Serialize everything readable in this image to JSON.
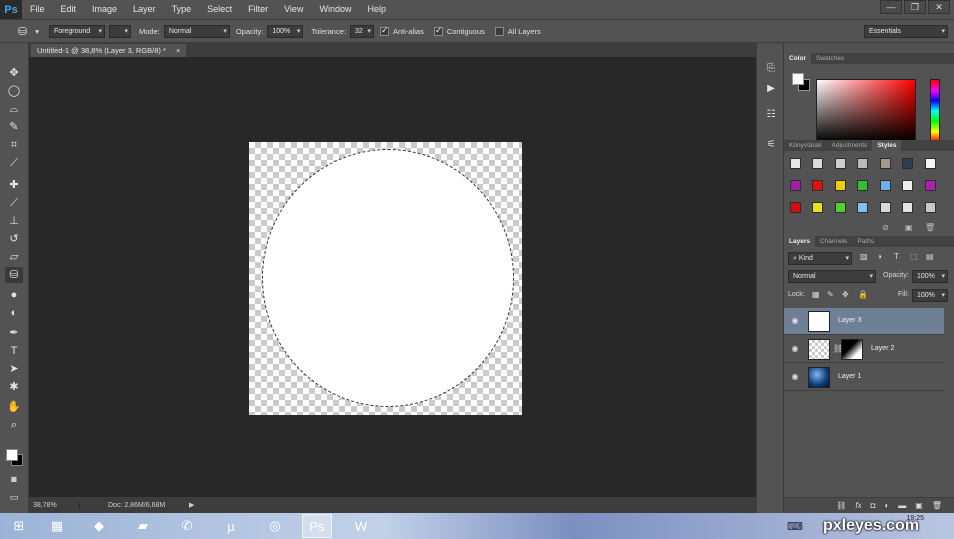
{
  "app": {
    "logo": "Ps"
  },
  "menu": [
    "File",
    "Edit",
    "Image",
    "Layer",
    "Type",
    "Select",
    "Filter",
    "View",
    "Window",
    "Help"
  ],
  "window_controls": {
    "minimize": "—",
    "restore": "❐",
    "close": "✕"
  },
  "options": {
    "fill_source": "Foreground",
    "mode_label": "Mode:",
    "mode_value": "Normal",
    "opacity_label": "Opacity:",
    "opacity_value": "100%",
    "tolerance_label": "Tolerance:",
    "tolerance_value": "32",
    "antialias_label": "Anti-alias",
    "contiguous_label": "Contiguous",
    "all_layers_label": "All Layers",
    "workspace": "Essentials"
  },
  "document": {
    "tab_title": "Untitled-1 @ 38,8% (Layer 3, RGB/8) *",
    "tab_close": "×"
  },
  "status": {
    "zoom": "38,78%",
    "doc_size": "Doc: 2,86M/6,68M",
    "arrow": "▶"
  },
  "panels": {
    "color_tabs": [
      "Color",
      "Swatches"
    ],
    "style_tabs": [
      "Könyvtárak",
      "Adjustments",
      "Styles"
    ],
    "layer_tabs": [
      "Layers",
      "Channels",
      "Paths"
    ],
    "kind_filter": "Kind",
    "blend_mode": "Normal",
    "opacity_label": "Opacity:",
    "opacity_value": "100%",
    "lock_label": "Lock:",
    "fill_label": "Fill:",
    "fill_value": "100%",
    "layers": [
      {
        "name": "Layer 3",
        "selected": true
      },
      {
        "name": "Layer 2",
        "selected": false
      },
      {
        "name": "Layer 1",
        "selected": false
      }
    ],
    "bottom_icons": [
      "link-icon",
      "fx-icon",
      "mask-icon",
      "adjustment-icon",
      "folder-icon",
      "new-layer-icon",
      "trash-icon"
    ]
  },
  "tools": [
    "move-icon",
    "marquee-icon",
    "lasso-icon",
    "quick-select-icon",
    "crop-icon",
    "eyedropper-icon",
    "healing-icon",
    "brush-icon",
    "stamp-icon",
    "history-brush-icon",
    "eraser-icon",
    "paint-bucket-icon",
    "blur-icon",
    "dodge-icon",
    "pen-icon",
    "type-icon",
    "path-select-icon",
    "shape-icon",
    "hand-icon",
    "zoom-icon"
  ],
  "taskbar": {
    "watermark": "pxleyes.com",
    "time": "19:25"
  },
  "colors": {
    "accent": "#3aa3f0",
    "selected_layer": "#6f7f96"
  }
}
